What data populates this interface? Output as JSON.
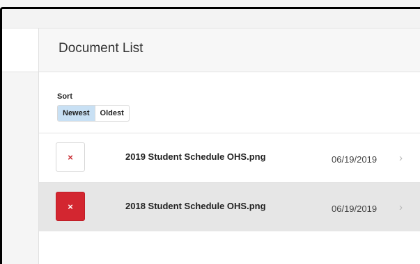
{
  "panel": {
    "title": "Document List"
  },
  "sort": {
    "label": "Sort",
    "options": [
      "Newest",
      "Oldest"
    ],
    "selected": "Newest"
  },
  "documents": [
    {
      "name": "2019 Student Schedule OHS.png",
      "date": "06/19/2019"
    },
    {
      "name": "2018 Student Schedule OHS.png",
      "date": "06/19/2019"
    }
  ],
  "icons": {
    "delete": "close-icon",
    "open": "chevron-right-icon",
    "delete_glyph": "×",
    "chevron_glyph": "›"
  },
  "colors": {
    "accent_sort": "#c8e0f4",
    "delete_red": "#d32630",
    "selected_row": "#e6e6e6"
  }
}
